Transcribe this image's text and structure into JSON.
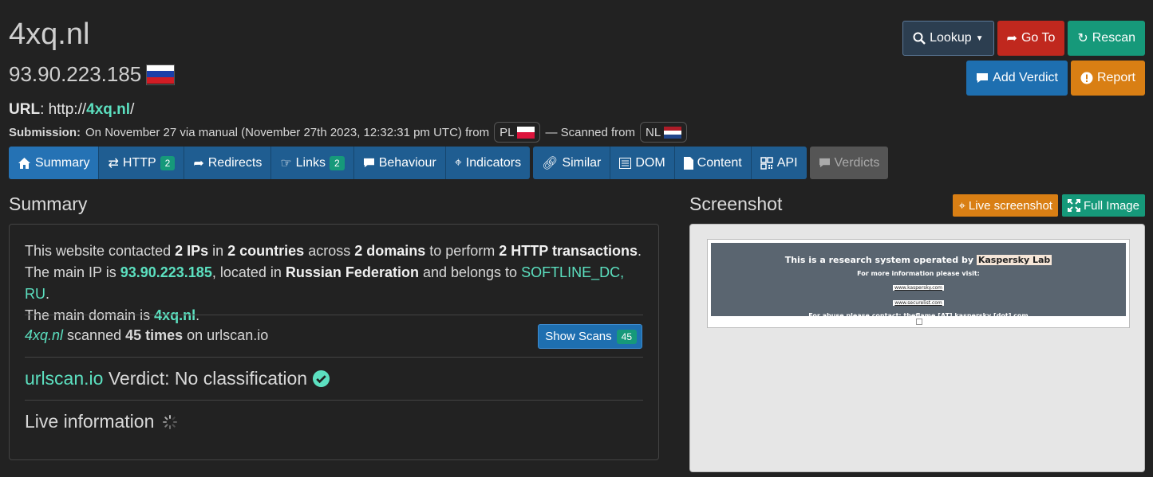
{
  "header": {
    "domain": "4xq.nl",
    "ip": "93.90.223.185",
    "url_prefix": "URL",
    "url_scheme": ": http://",
    "url_domain": "4xq.nl",
    "url_suffix": "/",
    "submission_label": "Submission:",
    "submission_text": "On November 27 via manual (November 27th 2023, 12:32:31 pm UTC) from",
    "from_country": "PL",
    "scanned_from_text": "— Scanned from",
    "scanned_country": "NL"
  },
  "actions": {
    "lookup": "Lookup",
    "goto": "Go To",
    "rescan": "Rescan",
    "add_verdict": "Add Verdict",
    "report": "Report"
  },
  "tabs": [
    {
      "label": "Summary"
    },
    {
      "label": "HTTP",
      "badge": "2"
    },
    {
      "label": "Redirects"
    },
    {
      "label": "Links",
      "badge": "2"
    },
    {
      "label": "Behaviour"
    },
    {
      "label": "Indicators"
    },
    {
      "label": "Similar"
    },
    {
      "label": "DOM"
    },
    {
      "label": "Content"
    },
    {
      "label": "API"
    },
    {
      "label": "Verdicts"
    }
  ],
  "summary": {
    "heading": "Summary",
    "t1": "This website contacted ",
    "ips": "2 IPs",
    "t2": " in ",
    "countries": "2 countries",
    "t3": " across ",
    "domains": "2 domains",
    "t4": " to perform ",
    "transactions": "2 HTTP transactions",
    "t5": ".",
    "t6": "The main IP is ",
    "main_ip": "93.90.223.185",
    "t7": ", located in ",
    "location": "Russian Federation",
    "t8": " and belongs to ",
    "asn": "SOFTLINE_DC, RU",
    "t9": ".",
    "t10": "The main domain is ",
    "main_domain": "4xq.nl",
    "t11": ".",
    "scans_domain": "4xq.nl",
    "scans_t1": " scanned ",
    "scans_count": "45 times",
    "scans_t2": " on urlscan.io",
    "show_scans": "Show Scans",
    "show_scans_badge": "45",
    "verdict_site": "urlscan.io",
    "verdict_text": " Verdict: No classification",
    "live_info": "Live information"
  },
  "screenshot": {
    "heading": "Screenshot",
    "live_btn": "Live screenshot",
    "full_btn": "Full Image",
    "banner_l1": "This is a research system operated by ",
    "banner_l1_hl": "Kaspersky Lab",
    "banner_l2": "For more information please visit:",
    "link1": "www.kaspersky.com",
    "link2": "www.securelist.com",
    "banner_l3": "For abuse please contact: theflame [AT] kaspersky [dot] com"
  },
  "colors": {
    "accent_teal": "#5ce0c0",
    "tab_blue": "#1f5d91",
    "btn_red": "#c0281e",
    "btn_teal": "#16997a",
    "btn_orange": "#d97f14"
  }
}
